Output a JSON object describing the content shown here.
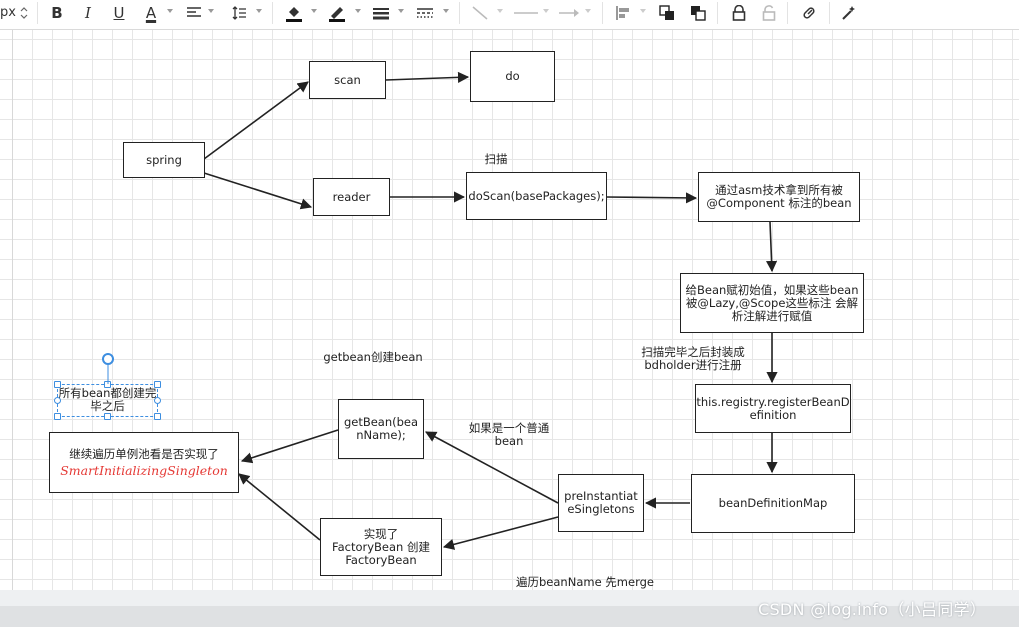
{
  "toolbar": {
    "unit_label": "px",
    "bold": "B",
    "italic": "I",
    "underline": "U",
    "font_color": "A",
    "icons": [
      "align-left-icon",
      "line-spacing-icon",
      "fill-color-icon",
      "line-color-icon",
      "line-width-icon",
      "line-style-icon",
      "connector-icon",
      "line-end-icon",
      "arrow-end-icon",
      "align-icon",
      "bring-front-icon",
      "send-back-icon",
      "lock-icon",
      "unlock-icon",
      "link-icon",
      "magic-icon"
    ]
  },
  "diagram": {
    "nodes": {
      "spring": "spring",
      "scan": "scan",
      "do": "do",
      "reader": "reader",
      "doScan": "doScan(basePackages);",
      "asm_line1": "通过asm技术拿到所有被",
      "asm_line2": "@Component 标注的bean",
      "init_line1": "给Bean赋初始值，如果这些bean",
      "init_line2": "被@Lazy,@Scope这些标注 会解",
      "init_line3": "析注解进行赋值",
      "register_line1": "this.registry.registerBeanD",
      "register_line2": "efinition",
      "beanDefinitionMap": "beanDefinitionMap",
      "preInst_line1": "preInstantiat",
      "preInst_line2": "eSingletons",
      "getBean_line1": "getBean(bea",
      "getBean_line2": "nName);",
      "factory_line1": "实现了",
      "factory_line2": "FactoryBean  创建",
      "factory_line3": "FactoryBean",
      "smart_line1": "继续遍历单例池看是否实现了",
      "smart_line2": "SmartInitializingSingleton",
      "selected_line1": "所有bean都创建完",
      "selected_line2": "毕之后"
    },
    "labels": {
      "scan_label": "扫描",
      "wrap_line1": "扫描完毕之后封装成",
      "wrap_line2": "bdholder进行注册",
      "getbean_create": "getbean创建bean",
      "normal_line1": "如果是一个普通",
      "normal_line2": "bean",
      "merge": "遍历beanName 先merge"
    }
  },
  "watermark": "CSDN @log.info（小吕同学）",
  "colors": {
    "stroke": "#222222",
    "grid": "#e6e6e6",
    "selection": "#3d8ee0",
    "math_text": "#e53935"
  }
}
